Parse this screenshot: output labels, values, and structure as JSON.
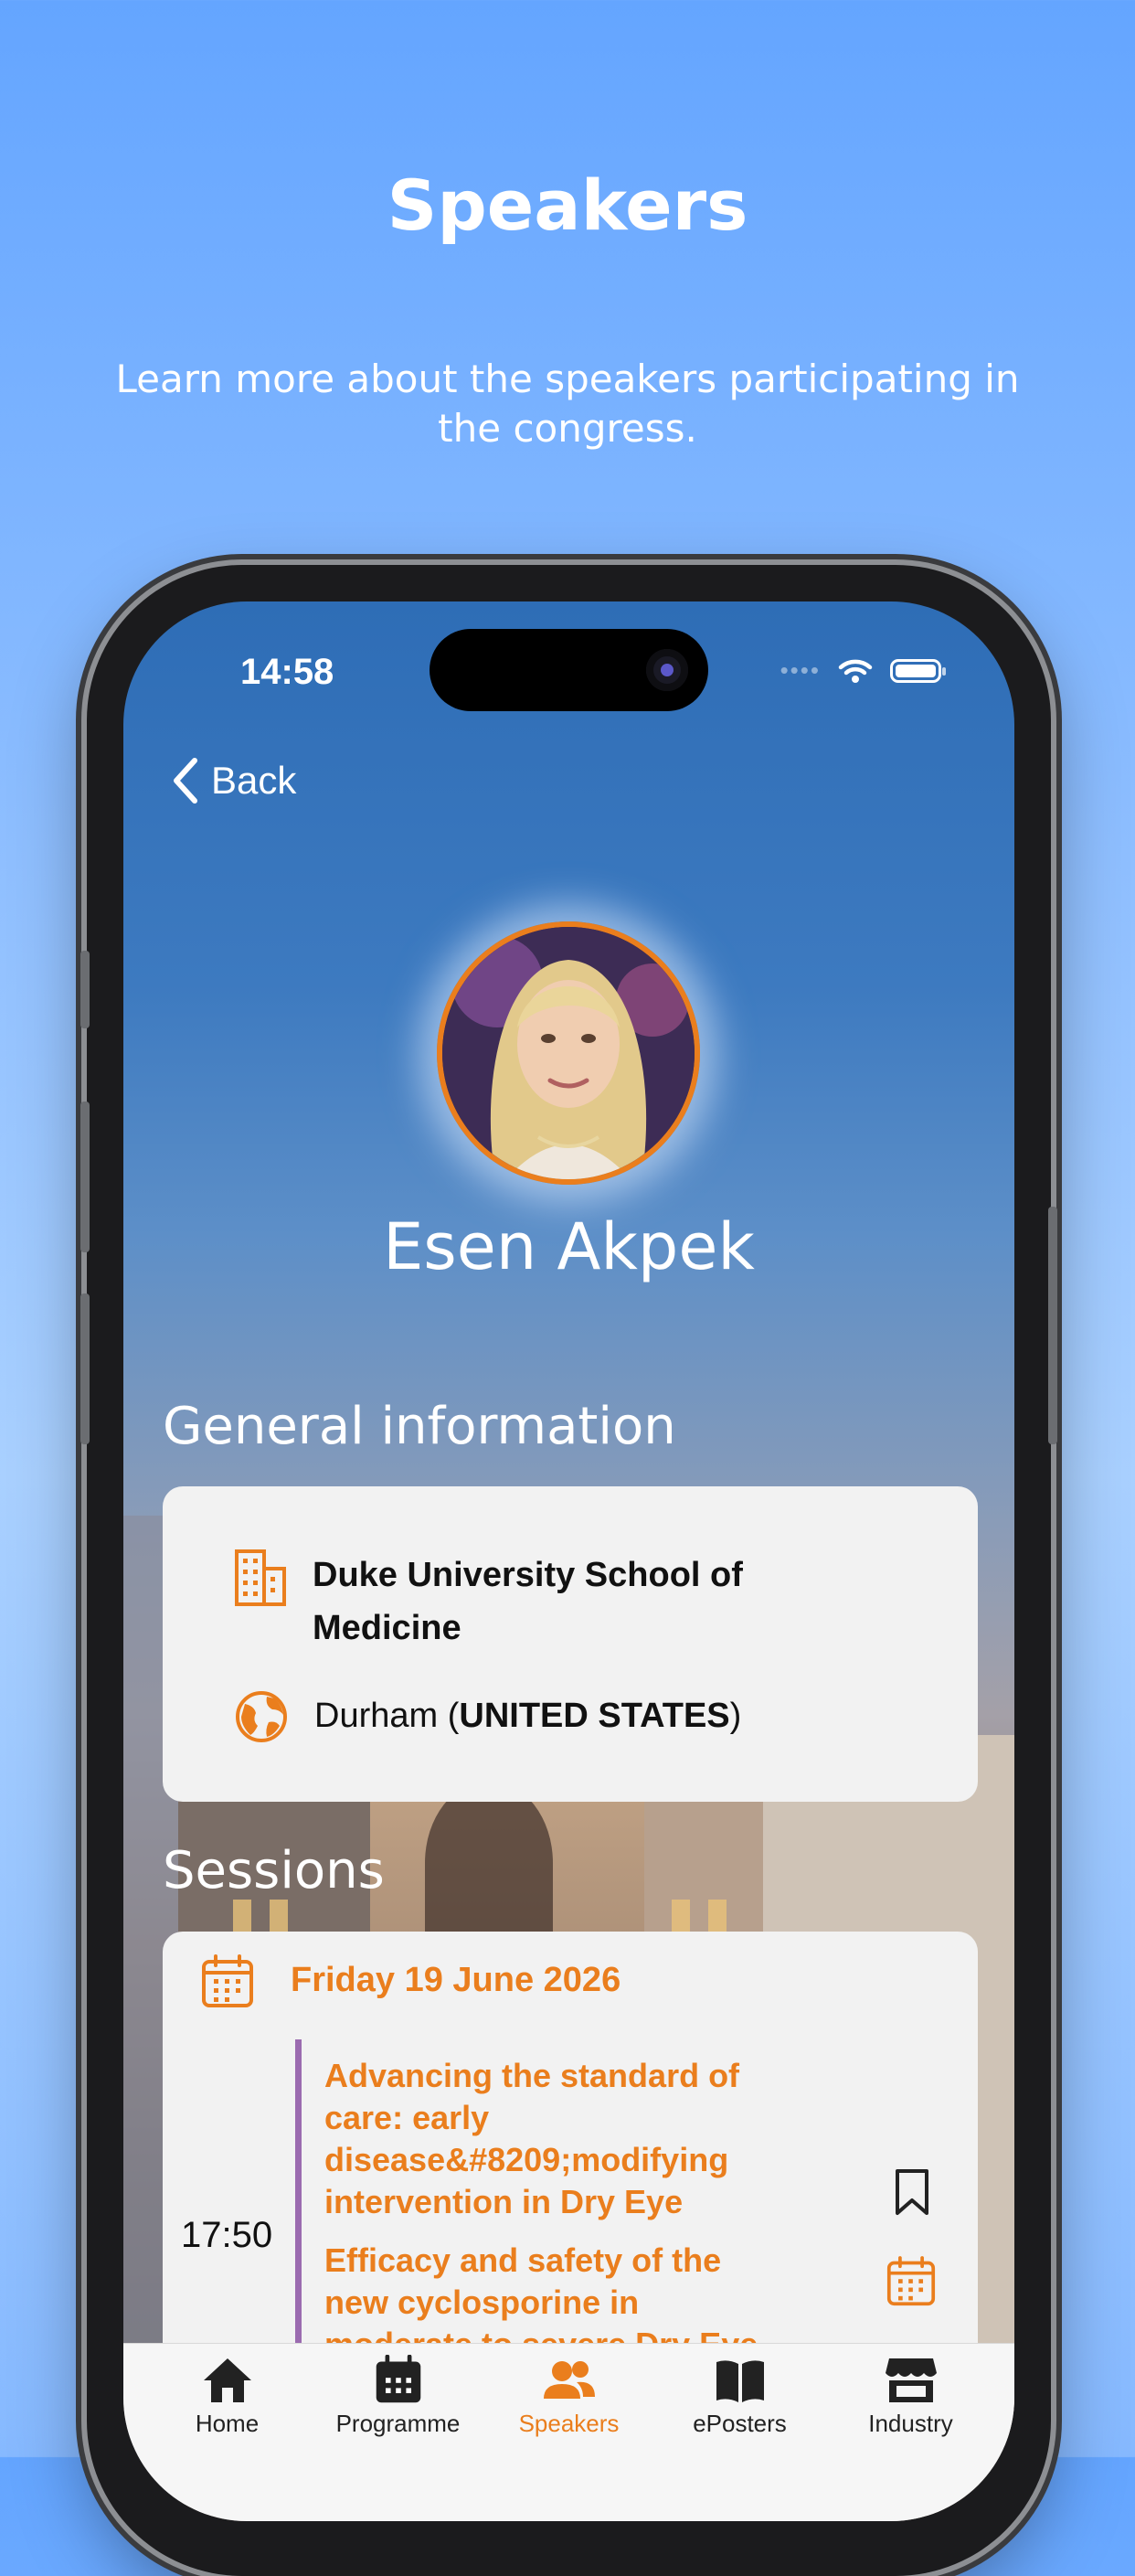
{
  "hero": {
    "title": "Speakers",
    "subtitle": "Learn more about the speakers participating in the congress."
  },
  "status_bar": {
    "time": "14:58"
  },
  "nav": {
    "back_label": "Back"
  },
  "speaker": {
    "name": "Esen Akpek",
    "photo_icon": "speaker-portrait"
  },
  "general_information": {
    "title": "General information",
    "institution": "Duke University School of Medicine",
    "city": "Durham",
    "country": "UNITED STATES"
  },
  "sessions": {
    "title": "Sessions",
    "items": [
      {
        "date": "Friday 19 June 2026",
        "time": "17:50",
        "title_1": "Advancing the standard of care: early disease&#8209;modifying intervention in Dry Eye",
        "title_2": "Efficacy and safety of the new cyclosporine in moderate to severe Dry Eye"
      }
    ]
  },
  "tabbar": {
    "items": [
      {
        "label": "Home",
        "icon": "home-icon"
      },
      {
        "label": "Programme",
        "icon": "calendar-icon"
      },
      {
        "label": "Speakers",
        "icon": "people-icon"
      },
      {
        "label": "ePosters",
        "icon": "book-icon"
      },
      {
        "label": "Industry",
        "icon": "store-icon"
      }
    ],
    "active": "Speakers"
  },
  "colors": {
    "accent": "#ea7e1d",
    "session_bar": "#9b6bb0",
    "card": "#f2f2f2"
  }
}
